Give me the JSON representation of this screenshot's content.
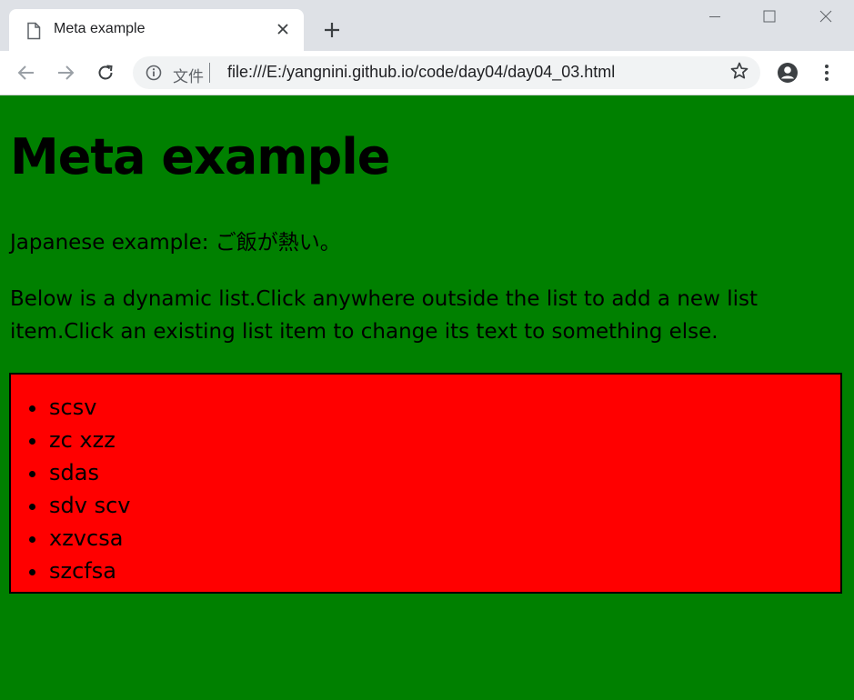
{
  "browser": {
    "tab": {
      "title": "Meta example",
      "icon": "document-icon"
    },
    "address_bar": {
      "scheme_label": "文件",
      "url": "file:///E:/yangnini.github.io/code/day04/day04_03.html"
    }
  },
  "page": {
    "background_color": "#008000",
    "heading": "Meta example",
    "japanese_example": "Japanese example: ご飯が熱い。",
    "instructions": "Below is a dynamic list.Click anywhere outside the list to add a new list item.Click an existing list item to change its text to something else.",
    "list": {
      "background_color": "#ff0000",
      "items": [
        "scsv",
        "zc xzz",
        "sdas",
        "sdv scv",
        "xzvcsa",
        "szcfsa"
      ]
    }
  }
}
